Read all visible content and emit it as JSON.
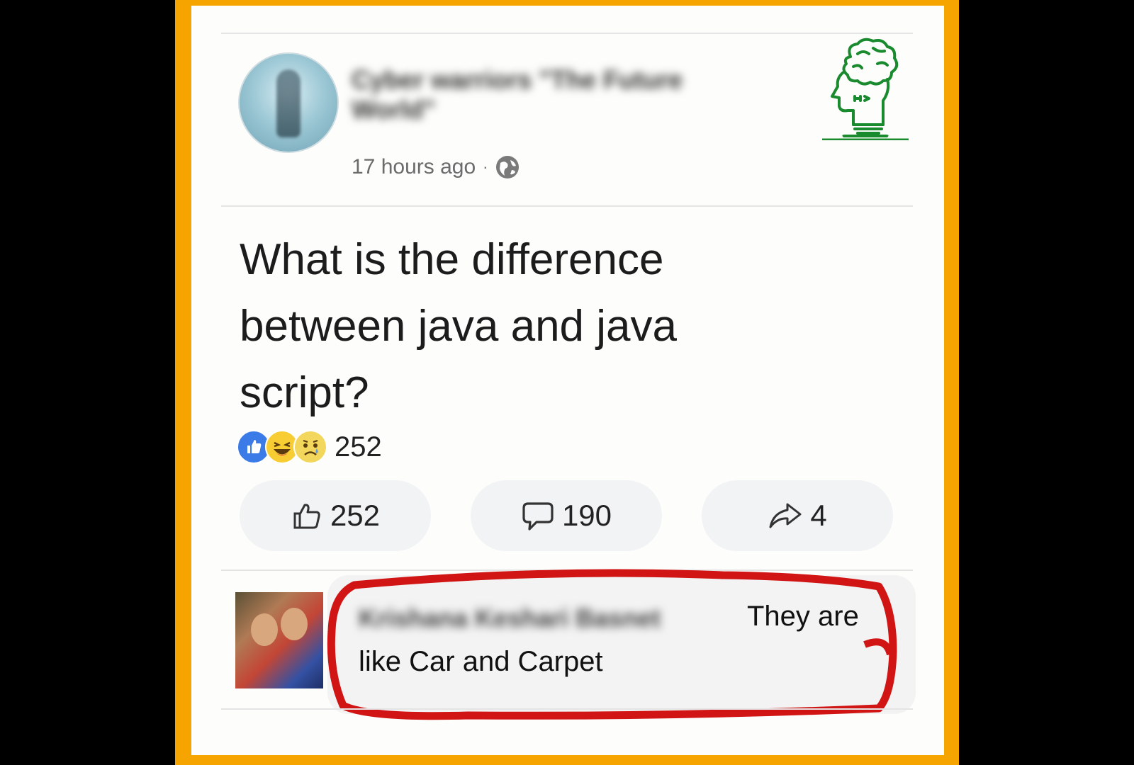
{
  "post": {
    "author": "Cyber warriors \"The Future World\"",
    "time": "17 hours ago",
    "separator": "·",
    "visibility_icon": "globe-icon",
    "text": "What is the difference between java and java script?"
  },
  "reactions": {
    "icons": [
      "like-reaction-icon",
      "haha-reaction-icon",
      "sad-reaction-icon"
    ],
    "count": "252"
  },
  "actions": {
    "like_count": "252",
    "comment_count": "190",
    "share_count": "4"
  },
  "comment": {
    "author": "Krishana Keshari Basnet",
    "line1": "They are",
    "line2": "like Car and Carpet"
  },
  "colors": {
    "frame": "#f5a400",
    "highlight": "#d11515",
    "logo": "#1a8a2e",
    "like_blue": "#3b7be8"
  }
}
